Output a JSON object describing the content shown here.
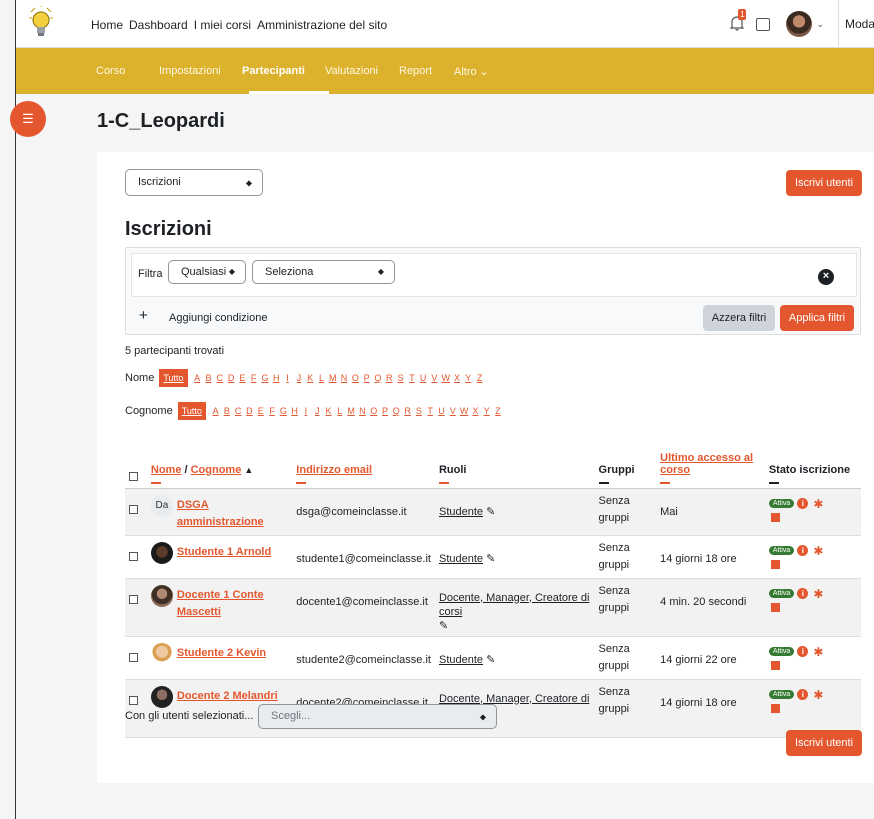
{
  "nav": {
    "links": [
      "Home",
      "Dashboard",
      "I miei corsi",
      "Amministrazione del sito"
    ],
    "notif_count": "1",
    "mode_label": "Modalit"
  },
  "secnav": {
    "tabs": [
      "Corso",
      "Impostazioni",
      "Partecipanti",
      "Valutazioni",
      "Report",
      "Altro ⌄"
    ]
  },
  "course_title": "1-C_Leopardi",
  "top_select": "Iscrizioni",
  "enrol_button": "Iscrivi utenti",
  "section_heading": "Iscrizioni",
  "filter": {
    "label": "Filtra",
    "match_value": "Qualsiasi",
    "type_value": "Seleziona",
    "add_condition": "Aggiungi condizione",
    "reset": "Azzera filtri",
    "apply": "Applica filtri"
  },
  "found_text": "5 partecipanti trovati",
  "initials": {
    "first_label": "Nome",
    "last_label": "Cognome",
    "all": "Tutto",
    "letters": [
      "A",
      "B",
      "C",
      "D",
      "E",
      "F",
      "G",
      "H",
      "I",
      "J",
      "K",
      "L",
      "M",
      "N",
      "O",
      "P",
      "Q",
      "R",
      "S",
      "T",
      "U",
      "V",
      "W",
      "X",
      "Y",
      "Z"
    ]
  },
  "table": {
    "headers": {
      "first": "Nome",
      "sep": " / ",
      "last": "Cognome",
      "email": "Indirizzo email",
      "roles": "Ruoli",
      "groups": "Gruppi",
      "access": "Ultimo accesso al corso",
      "status": "Stato iscrizione"
    },
    "rows": [
      {
        "initials": "Da",
        "name": "DSGA amministrazione",
        "email": "dsga@comeinclasse.it",
        "roles": "Studente",
        "groups": "Senza gruppi",
        "access": "Mai",
        "status": "Attiva"
      },
      {
        "initials": "",
        "name": "Studente 1 Arnold",
        "email": "studente1@comeinclasse.it",
        "roles": "Studente",
        "groups": "Senza gruppi",
        "access": "14 giorni 18 ore",
        "status": "Attiva"
      },
      {
        "initials": "",
        "name": "Docente 1 Conte Mascetti",
        "email": "docente1@comeinclasse.it",
        "roles": "Docente, Manager, Creatore di corsi",
        "groups": "Senza gruppi",
        "access": "4 min. 20 secondi",
        "status": "Attiva"
      },
      {
        "initials": "",
        "name": "Studente 2 Kevin",
        "email": "studente2@comeinclasse.it",
        "roles": "Studente",
        "groups": "Senza gruppi",
        "access": "14 giorni 22 ore",
        "status": "Attiva"
      },
      {
        "initials": "",
        "name": "Docente 2 Melandri",
        "email": "docente2@comeinclasse.it",
        "roles": "Docente, Manager, Creatore di corsi",
        "groups": "Senza gruppi",
        "access": "14 giorni 18 ore",
        "status": "Attiva"
      }
    ]
  },
  "bulk": {
    "label": "Con gli utenti selezionati...",
    "placeholder": "Scegli..."
  },
  "colors": {
    "accent": "#e4572e",
    "secnav": "#dcb12c",
    "active_pill": "#357a32"
  },
  "icons": [
    "bulb-logo-icon",
    "bell-icon",
    "chat-icon",
    "user-avatar",
    "drawer-index-icon",
    "close-icon",
    "plus-icon",
    "sort-up-icon",
    "pencil-icon",
    "info-icon",
    "gear-icon",
    "trash-icon"
  ]
}
